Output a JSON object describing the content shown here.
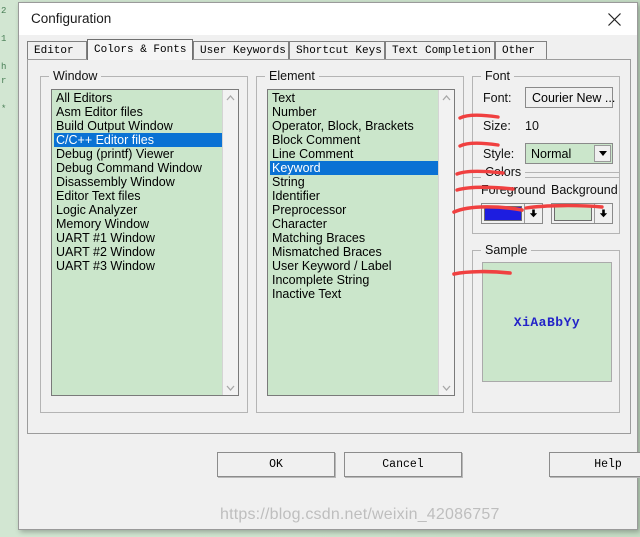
{
  "background": {
    "gutter_lines": "2\n\n1\n\nh\nr\n\n*"
  },
  "dialog": {
    "title": "Configuration",
    "close_icon": "close-icon"
  },
  "tabs": [
    {
      "label": "Editor",
      "active": false
    },
    {
      "label": "Colors & Fonts",
      "active": true
    },
    {
      "label": "User Keywords",
      "active": false
    },
    {
      "label": "Shortcut Keys",
      "active": false
    },
    {
      "label": "Text Completion",
      "active": false
    },
    {
      "label": "Other",
      "active": false
    }
  ],
  "window_group": {
    "legend": "Window",
    "items": [
      "All Editors",
      "Asm Editor files",
      "Build Output Window",
      "C/C++ Editor files",
      "Debug (printf) Viewer",
      "Debug Command Window",
      "Disassembly Window",
      "Editor Text files",
      "Logic Analyzer",
      "Memory Window",
      "UART #1 Window",
      "UART #2 Window",
      "UART #3 Window"
    ],
    "selected_index": 3,
    "scroll_up_icon": "chevron-up-icon",
    "scroll_down_icon": "chevron-down-icon"
  },
  "element_group": {
    "legend": "Element",
    "items": [
      "Text",
      "Number",
      "Operator, Block, Brackets",
      "Block Comment",
      "Line Comment",
      "Keyword",
      "String",
      "Identifier",
      "Preprocessor",
      "Character",
      "Matching Braces",
      "Mismatched Braces",
      "User Keyword / Label",
      "Incomplete String",
      "Inactive Text"
    ],
    "selected_index": 5,
    "scroll_up_icon": "chevron-up-icon",
    "scroll_down_icon": "chevron-down-icon"
  },
  "font_group": {
    "legend": "Font",
    "font_label": "Font:",
    "font_value": "Courier New ...",
    "size_label": "Size:",
    "size_value": "10",
    "style_label": "Style:",
    "style_value": "Normal",
    "style_arrow_icon": "chevron-down-icon"
  },
  "colors_group": {
    "legend": "Colors",
    "foreground_label": "Foreground",
    "background_label": "Background",
    "foreground_color": "#1d1de0",
    "background_color": "#cbe6cb",
    "dropdown_icon": "arrow-down-icon"
  },
  "sample_group": {
    "legend": "Sample",
    "sample_text": "XiAaBbYy",
    "sample_fg": "#2323c8",
    "sample_bg": "#cbe6cb"
  },
  "buttons": {
    "ok": "OK",
    "cancel": "Cancel",
    "help": "Help"
  },
  "watermark": {
    "text": "https://blog.csdn.net/weixin_42086757"
  },
  "annotations": {
    "color": "#f04040",
    "strokes": [
      "underline-font-label",
      "underline-size-label",
      "underline-style-label",
      "underline-colors-legend",
      "underline-foreground-label",
      "underline-background-label",
      "underline-sample-legend"
    ]
  }
}
